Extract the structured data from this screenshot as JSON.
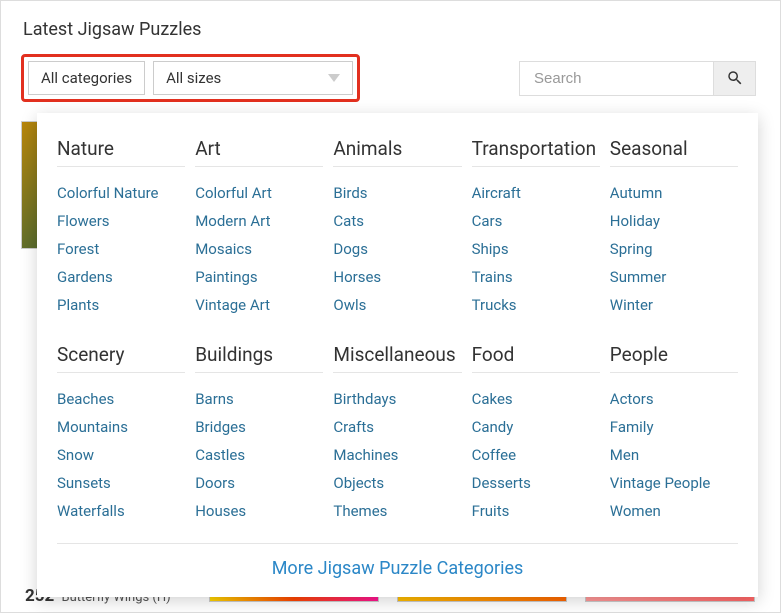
{
  "title": "Latest Jigsaw Puzzles",
  "filters": {
    "categories_label": "All categories",
    "sizes_label": "All sizes"
  },
  "search": {
    "placeholder": "Search"
  },
  "mega": {
    "columns": [
      {
        "heading": "Nature",
        "items": [
          "Colorful Nature",
          "Flowers",
          "Forest",
          "Gardens",
          "Plants"
        ]
      },
      {
        "heading": "Art",
        "items": [
          "Colorful Art",
          "Modern Art",
          "Mosaics",
          "Paintings",
          "Vintage Art"
        ]
      },
      {
        "heading": "Animals",
        "items": [
          "Birds",
          "Cats",
          "Dogs",
          "Horses",
          "Owls"
        ]
      },
      {
        "heading": "Transportation",
        "items": [
          "Aircraft",
          "Cars",
          "Ships",
          "Trains",
          "Trucks"
        ]
      },
      {
        "heading": "Seasonal",
        "items": [
          "Autumn",
          "Holiday",
          "Spring",
          "Summer",
          "Winter"
        ]
      },
      {
        "heading": "Scenery",
        "items": [
          "Beaches",
          "Mountains",
          "Snow",
          "Sunsets",
          "Waterfalls"
        ]
      },
      {
        "heading": "Buildings",
        "items": [
          "Barns",
          "Bridges",
          "Castles",
          "Doors",
          "Houses"
        ]
      },
      {
        "heading": "Miscellaneous",
        "items": [
          "Birthdays",
          "Crafts",
          "Machines",
          "Objects",
          "Themes"
        ]
      },
      {
        "heading": "Food",
        "items": [
          "Cakes",
          "Candy",
          "Coffee",
          "Desserts",
          "Fruits"
        ]
      },
      {
        "heading": "People",
        "items": [
          "Actors",
          "Family",
          "Men",
          "Vintage People",
          "Women"
        ]
      }
    ],
    "more_link": "More Jigsaw Puzzle Categories"
  },
  "background_puzzle": {
    "count": "252",
    "title": "Butterfly Wings (H)"
  }
}
